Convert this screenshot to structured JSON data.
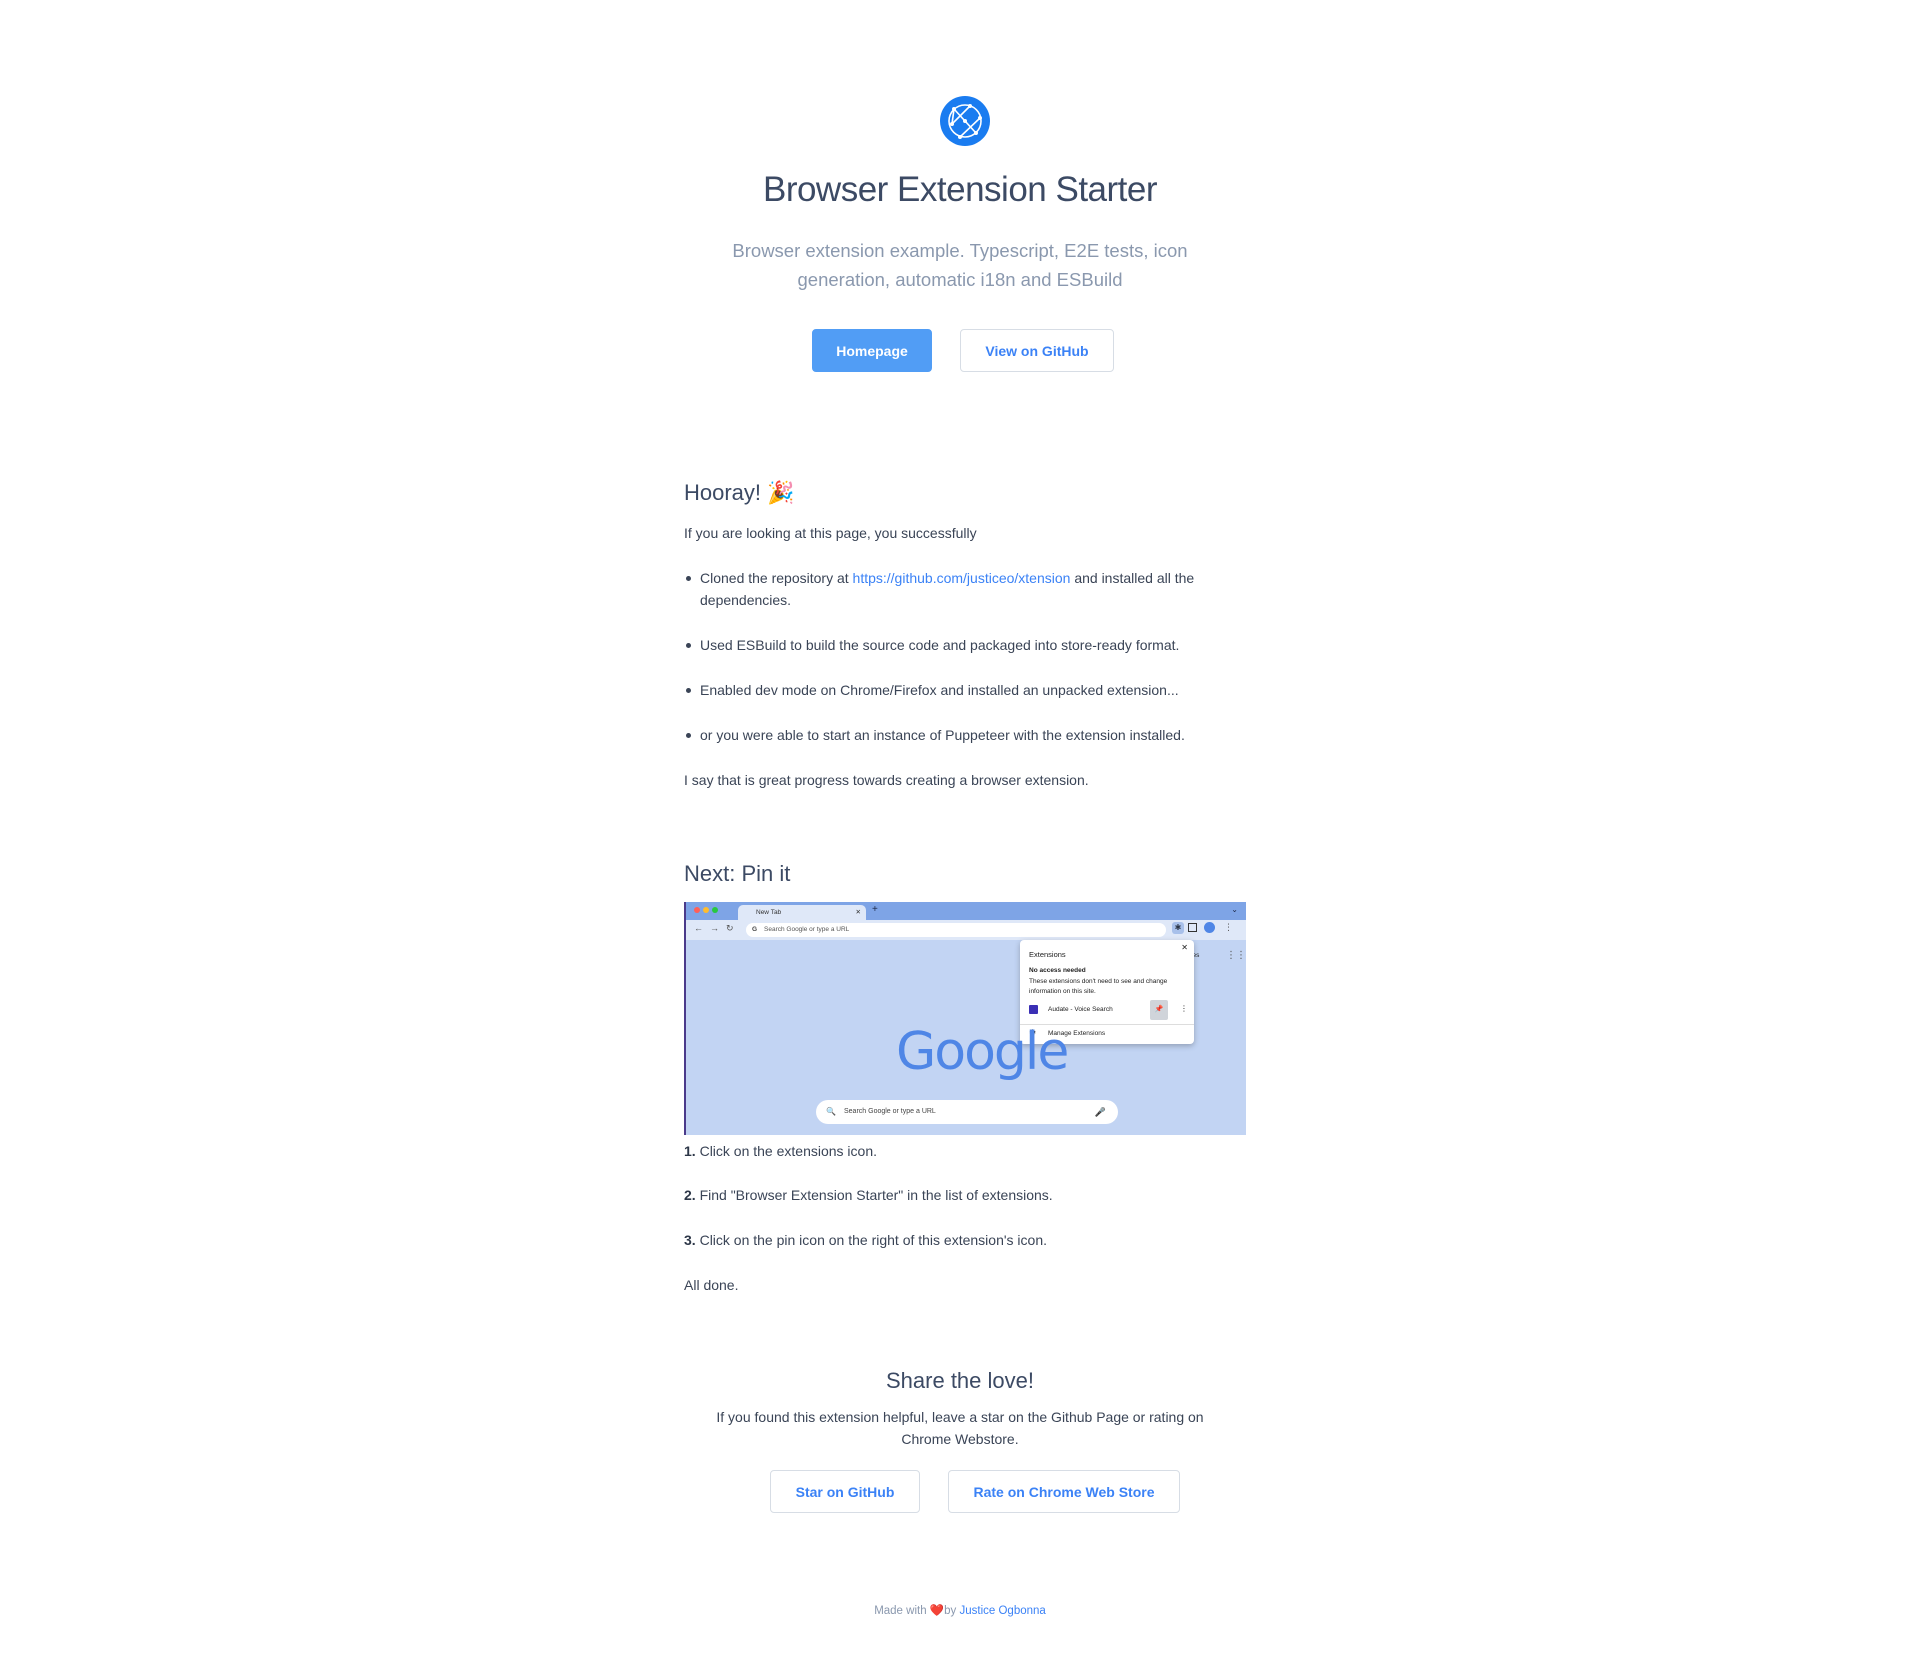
{
  "header": {
    "logo_icon": "globe-network-icon",
    "title": "Browser Extension Starter",
    "subtitle": "Browser extension example. Typescript, E2E tests, icon generation, automatic i18n and ESBuild",
    "homepage_label": "Homepage",
    "github_label": "View on GitHub"
  },
  "hooray": {
    "heading": "Hooray!",
    "heading_emoji": "🎉",
    "intro": "If you are looking at this page, you successfully",
    "bullets": [
      {
        "before": "Cloned the repository at ",
        "link": "https://github.com/justiceo/xtension",
        "after": " and installed all the dependencies."
      },
      {
        "text": "Used ESBuild to build the source code and packaged into store-ready format."
      },
      {
        "text": "Enabled dev mode on Chrome/Firefox and installed an unpacked extension..."
      },
      {
        "text": "or you were able to start an instance of Puppeteer with the extension installed."
      }
    ],
    "outro": "I say that is great progress towards creating a browser extension."
  },
  "pin": {
    "heading": "Next: Pin it",
    "screenshot": {
      "tab_label": "New Tab",
      "url_placeholder": "Search Google or type a URL",
      "popup_title": "Extensions",
      "popup_subtitle": "No access needed",
      "popup_desc": "These extensions don't need to see and change information on this site.",
      "popup_item": "Audate - Voice Search",
      "popup_manage": "Manage Extensions",
      "images_label": "Images",
      "google_logo": "Google",
      "search_placeholder": "Search Google or type a URL"
    },
    "steps": [
      {
        "num": "1.",
        "text": " Click on the extensions icon."
      },
      {
        "num": "2.",
        "text": " Find \"Browser Extension Starter\" in the list of extensions."
      },
      {
        "num": "3.",
        "text": " Click on the pin icon on the right of this extension's icon."
      }
    ],
    "done": "All done."
  },
  "share": {
    "heading": "Share the love!",
    "text": "If you found this extension helpful, leave a star on the Github Page or rating on Chrome Webstore.",
    "star_label": "Star on GitHub",
    "rate_label": "Rate on Chrome Web Store"
  },
  "footer": {
    "made_with": "Made with",
    "heart": "❤️",
    "by": "by",
    "author": "Justice Ogbonna"
  },
  "colors": {
    "primary": "#519df5",
    "link": "#3b82f6",
    "logo": "#1a7cf0"
  }
}
